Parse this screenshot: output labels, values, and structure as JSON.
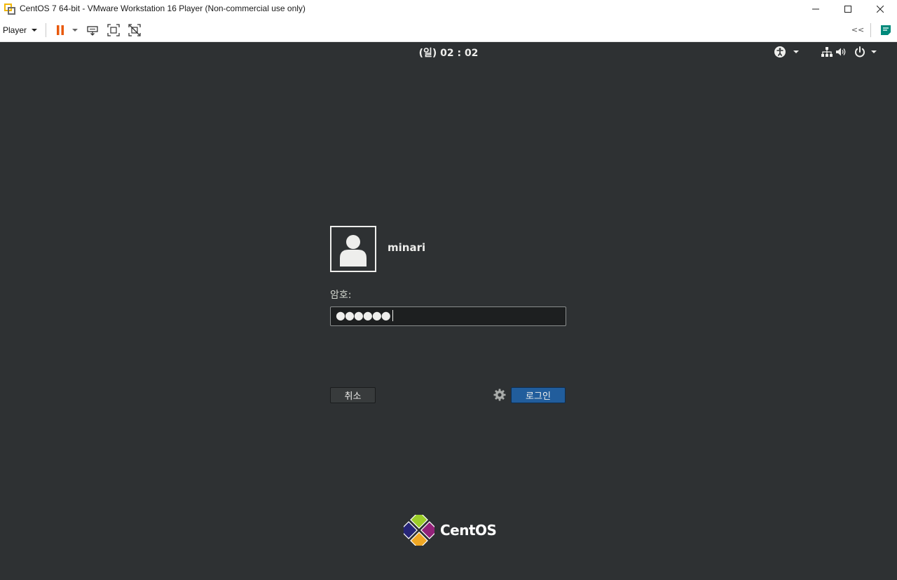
{
  "window": {
    "title": "CentOS 7 64-bit - VMware Workstation 16 Player (Non-commercial use only)",
    "controls": [
      "minimize-icon",
      "maximize-icon",
      "close-icon"
    ]
  },
  "toolbar": {
    "player_label": "Player",
    "icons": [
      "pause-icon",
      "dropdown-arrow-icon",
      "send-ctrl-alt-del-icon",
      "fullscreen-icon",
      "unity-icon",
      "collapse-icon",
      "message-icon"
    ],
    "collapse_label": "<<",
    "colors": {
      "pause": "#e8590c",
      "accent": "#00897b"
    }
  },
  "guest": {
    "topbar": {
      "clock": "(일) 02 : 02",
      "icons": [
        "accessibility-icon",
        "network-icon",
        "volume-icon",
        "power-icon"
      ]
    },
    "login": {
      "username": "minari",
      "password_label": "암호:",
      "password_masked": "●●●●●●",
      "cancel_label": "취소",
      "login_label": "로그인",
      "settings_icon": "gear-icon"
    },
    "logo_text": "CentOS",
    "colors": {
      "background": "#2e3133",
      "login_button": "#215d9c"
    }
  }
}
